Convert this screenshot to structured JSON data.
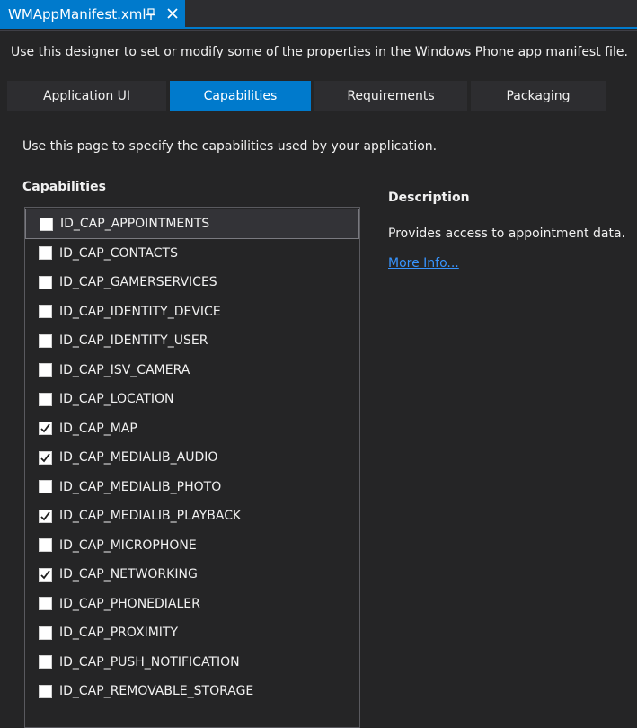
{
  "document_tab": {
    "title": "WMAppManifest.xml",
    "pin_icon": "pin-icon",
    "close_icon": "close-icon"
  },
  "intro_text": "Use this designer to set or modify some of the properties in the Windows Phone app manifest file.",
  "tabs": [
    {
      "label": "Application UI",
      "active": false
    },
    {
      "label": "Capabilities",
      "active": true
    },
    {
      "label": "Requirements",
      "active": false
    },
    {
      "label": "Packaging",
      "active": false
    }
  ],
  "page_description": "Use this page to specify the capabilities used by your application.",
  "capabilities": {
    "heading": "Capabilities",
    "items": [
      {
        "label": "ID_CAP_APPOINTMENTS",
        "checked": false,
        "selected": true
      },
      {
        "label": "ID_CAP_CONTACTS",
        "checked": false
      },
      {
        "label": "ID_CAP_GAMERSERVICES",
        "checked": false
      },
      {
        "label": "ID_CAP_IDENTITY_DEVICE",
        "checked": false
      },
      {
        "label": "ID_CAP_IDENTITY_USER",
        "checked": false
      },
      {
        "label": "ID_CAP_ISV_CAMERA",
        "checked": false
      },
      {
        "label": "ID_CAP_LOCATION",
        "checked": false
      },
      {
        "label": "ID_CAP_MAP",
        "checked": true
      },
      {
        "label": "ID_CAP_MEDIALIB_AUDIO",
        "checked": true
      },
      {
        "label": "ID_CAP_MEDIALIB_PHOTO",
        "checked": false
      },
      {
        "label": "ID_CAP_MEDIALIB_PLAYBACK",
        "checked": true
      },
      {
        "label": "ID_CAP_MICROPHONE",
        "checked": false
      },
      {
        "label": "ID_CAP_NETWORKING",
        "checked": true
      },
      {
        "label": "ID_CAP_PHONEDIALER",
        "checked": false
      },
      {
        "label": "ID_CAP_PROXIMITY",
        "checked": false
      },
      {
        "label": "ID_CAP_PUSH_NOTIFICATION",
        "checked": false
      },
      {
        "label": "ID_CAP_REMOVABLE_STORAGE",
        "checked": false
      }
    ]
  },
  "description": {
    "heading": "Description",
    "text": "Provides access to appointment data.",
    "more_link": "More Info..."
  },
  "colors": {
    "accent": "#007acc",
    "background": "#252526",
    "link": "#3794ff"
  }
}
